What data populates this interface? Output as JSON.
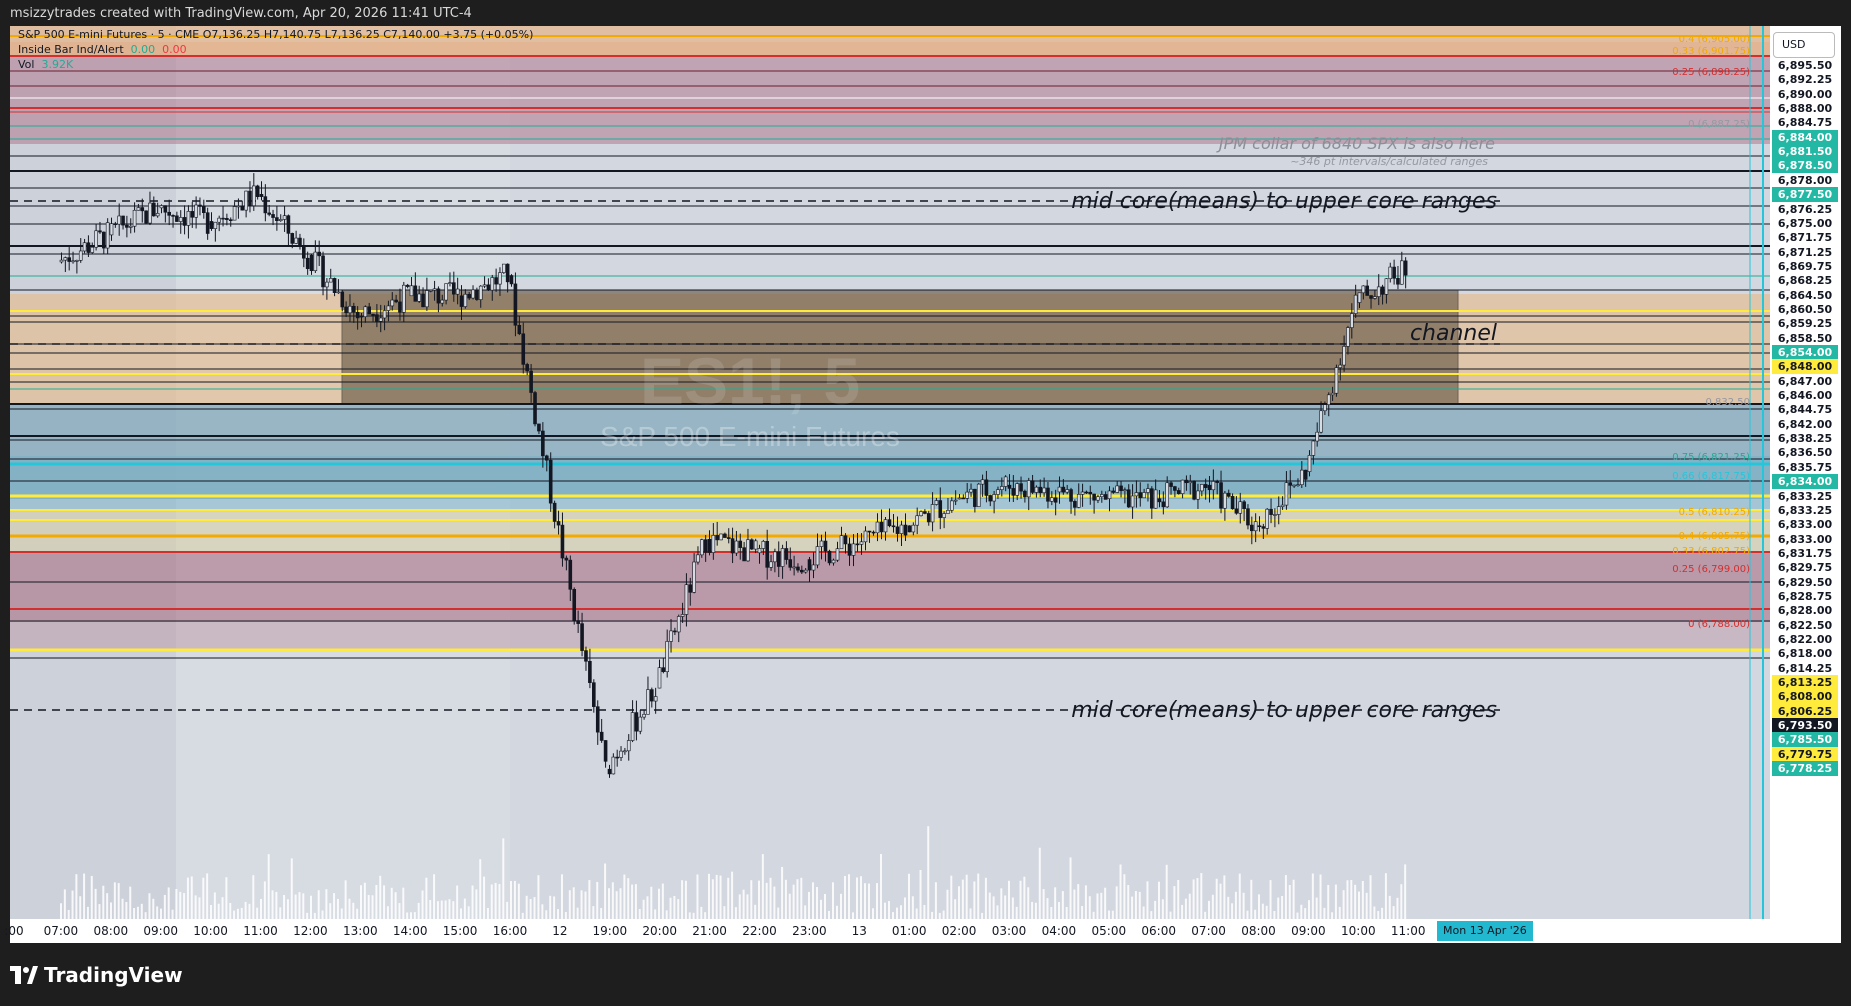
{
  "header": {
    "credit": "msizzytrades created with TradingView.com, Apr 20, 2026 11:41 UTC-4"
  },
  "legend": {
    "symbol_line": "S&P 500 E-mini Futures · 5 · CME  O7,136.25  H7,140.75  L7,136.25  C7,140.00  +3.75 (+0.05%)",
    "indicator_name": "Inside Bar Ind/Alert",
    "indicator_v1": "0.00",
    "indicator_v2": "0.00",
    "volume_name": "Vol",
    "volume_value": "3.92K"
  },
  "watermark": {
    "symbol": "ES1!, 5",
    "name": "S&P 500 E-mini Futures"
  },
  "annotations": {
    "jpm_collar": "JPM collar of 6840 SPX is also here",
    "intervals": "~346 pt intervals/calculated ranges",
    "mid_core_top": "mid core(means) to upper core ranges",
    "channel": "channel",
    "mid_core_bottom": "mid core(means) to upper core ranges"
  },
  "fib_labels": [
    {
      "text": "0.4 (6,905.00)",
      "color": "#f2a900"
    },
    {
      "text": "0.33 (6,901.75)",
      "color": "#f2a900"
    },
    {
      "text": "0.25 (6,898.25)",
      "color": "#d32f2f"
    },
    {
      "text": "0 (6,887.25)",
      "color": "#9598a1"
    },
    {
      "text": "0.832.50",
      "color": "#9598a1"
    },
    {
      "text": "0.75 (6,821.25)",
      "color": "#22ab94"
    },
    {
      "text": "0.66 (6,817.75)",
      "color": "#26c6da"
    },
    {
      "text": "0.5 (6,810.25)",
      "color": "#f2a900"
    },
    {
      "text": "0.4 (6,805.75)",
      "color": "#f2a900"
    },
    {
      "text": "0.33 (6,802.75)",
      "color": "#f2a900"
    },
    {
      "text": "0.25 (6,799.00)",
      "color": "#d32f2f"
    },
    {
      "text": "0 (6,788.00)",
      "color": "#d32f2f"
    }
  ],
  "price_axis": {
    "currency": "USD",
    "labels": [
      {
        "v": "6,895.50",
        "bg": "#ffffff",
        "fg": "#131722"
      },
      {
        "v": "6,892.25",
        "bg": "#ffffff",
        "fg": "#131722"
      },
      {
        "v": "6,890.00",
        "bg": "#ffffff",
        "fg": "#131722"
      },
      {
        "v": "6,888.00",
        "bg": "#ffffff",
        "fg": "#131722"
      },
      {
        "v": "6,884.75",
        "bg": "#ffffff",
        "fg": "#131722"
      },
      {
        "v": "6,884.00",
        "bg": "#22b8a4",
        "fg": "#ffffff"
      },
      {
        "v": "6,881.50",
        "bg": "#22b8a4",
        "fg": "#ffffff"
      },
      {
        "v": "6,878.50",
        "bg": "#22b8a4",
        "fg": "#ffffff"
      },
      {
        "v": "6,878.00",
        "bg": "#ffffff",
        "fg": "#131722"
      },
      {
        "v": "6,877.50",
        "bg": "#22b8a4",
        "fg": "#ffffff"
      },
      {
        "v": "6,876.25",
        "bg": "#ffffff",
        "fg": "#131722"
      },
      {
        "v": "6,875.00",
        "bg": "#ffffff",
        "fg": "#131722"
      },
      {
        "v": "6,871.75",
        "bg": "#ffffff",
        "fg": "#131722"
      },
      {
        "v": "6,871.25",
        "bg": "#ffffff",
        "fg": "#131722"
      },
      {
        "v": "6,869.75",
        "bg": "#ffffff",
        "fg": "#131722"
      },
      {
        "v": "6,868.25",
        "bg": "#ffffff",
        "fg": "#131722"
      },
      {
        "v": "6,864.50",
        "bg": "#ffffff",
        "fg": "#131722"
      },
      {
        "v": "6,860.50",
        "bg": "#ffffff",
        "fg": "#131722"
      },
      {
        "v": "6,859.25",
        "bg": "#ffffff",
        "fg": "#131722"
      },
      {
        "v": "6,858.50",
        "bg": "#ffffff",
        "fg": "#131722"
      },
      {
        "v": "6,854.00",
        "bg": "#22b8a4",
        "fg": "#ffffff"
      },
      {
        "v": "6,848.00",
        "bg": "#ffeb3b",
        "fg": "#131722"
      },
      {
        "v": "6,847.00",
        "bg": "#ffffff",
        "fg": "#131722"
      },
      {
        "v": "6,846.00",
        "bg": "#ffffff",
        "fg": "#131722"
      },
      {
        "v": "6,844.75",
        "bg": "#ffffff",
        "fg": "#131722"
      },
      {
        "v": "6,842.00",
        "bg": "#ffffff",
        "fg": "#131722"
      },
      {
        "v": "6,838.25",
        "bg": "#ffffff",
        "fg": "#131722"
      },
      {
        "v": "6,836.50",
        "bg": "#ffffff",
        "fg": "#131722"
      },
      {
        "v": "6,835.75",
        "bg": "#ffffff",
        "fg": "#131722"
      },
      {
        "v": "6,834.00",
        "bg": "#22b8a4",
        "fg": "#ffffff"
      },
      {
        "v": "6,833.25",
        "bg": "#ffffff",
        "fg": "#131722"
      },
      {
        "v": "6,833.25",
        "bg": "#ffffff",
        "fg": "#131722"
      },
      {
        "v": "6,833.00",
        "bg": "#ffffff",
        "fg": "#131722"
      },
      {
        "v": "6,833.00",
        "bg": "#ffffff",
        "fg": "#131722"
      },
      {
        "v": "6,831.75",
        "bg": "#ffffff",
        "fg": "#131722"
      },
      {
        "v": "6,829.75",
        "bg": "#ffffff",
        "fg": "#131722"
      },
      {
        "v": "6,829.50",
        "bg": "#ffffff",
        "fg": "#131722"
      },
      {
        "v": "6,828.75",
        "bg": "#ffffff",
        "fg": "#131722"
      },
      {
        "v": "6,828.00",
        "bg": "#ffffff",
        "fg": "#131722"
      },
      {
        "v": "6,822.50",
        "bg": "#ffffff",
        "fg": "#131722"
      },
      {
        "v": "6,822.00",
        "bg": "#ffffff",
        "fg": "#131722"
      },
      {
        "v": "6,818.00",
        "bg": "#ffffff",
        "fg": "#131722"
      },
      {
        "v": "6,814.25",
        "bg": "#ffffff",
        "fg": "#131722"
      },
      {
        "v": "6,813.25",
        "bg": "#ffeb3b",
        "fg": "#131722"
      },
      {
        "v": "6,808.00",
        "bg": "#ffeb3b",
        "fg": "#131722"
      },
      {
        "v": "6,806.25",
        "bg": "#ffeb3b",
        "fg": "#131722"
      },
      {
        "v": "6,793.50",
        "bg": "#131722",
        "fg": "#ffffff"
      },
      {
        "v": "6,785.50",
        "bg": "#22b8a4",
        "fg": "#ffffff"
      },
      {
        "v": "6,779.75",
        "bg": "#ffeb3b",
        "fg": "#131722"
      },
      {
        "v": "6,778.25",
        "bg": "#22b8a4",
        "fg": "#ffffff"
      }
    ]
  },
  "time_axis": {
    "labels": [
      ":00",
      "07:00",
      "08:00",
      "09:00",
      "10:00",
      "11:00",
      "12:00",
      "13:00",
      "14:00",
      "15:00",
      "16:00",
      "12",
      "19:00",
      "20:00",
      "21:00",
      "22:00",
      "23:00",
      "13",
      "01:00",
      "02:00",
      "03:00",
      "04:00",
      "05:00",
      "06:00",
      "07:00",
      "08:00",
      "09:00",
      "10:00",
      "11:00"
    ],
    "current_date": "Mon 13 Apr '26"
  },
  "footer": {
    "brand": "TradingView"
  },
  "chart_data": {
    "type": "candlestick",
    "symbol": "ES1!",
    "interval": "5",
    "series": [
      {
        "name": "Vol",
        "type": "volume"
      }
    ],
    "ylim": [
      6778.25,
      6905.0
    ],
    "bars": [
      {
        "time": "07:00",
        "close": 6871
      },
      {
        "time": "08:00",
        "close": 6875
      },
      {
        "time": "09:00",
        "close": 6879
      },
      {
        "time": "10:00",
        "close": 6877
      },
      {
        "time": "11:00",
        "close": 6881
      },
      {
        "time": "12:00",
        "close": 6872
      },
      {
        "time": "13:00",
        "close": 6863
      },
      {
        "time": "14:00",
        "close": 6866
      },
      {
        "time": "15:00",
        "close": 6866
      },
      {
        "time": "16:00",
        "close": 6869
      },
      {
        "time": "19:00",
        "close": 6796
      },
      {
        "time": "20:00",
        "close": 6808
      },
      {
        "time": "21:00",
        "close": 6830
      },
      {
        "time": "22:00",
        "close": 6828
      },
      {
        "time": "23:00",
        "close": 6827
      },
      {
        "time": "01:00",
        "close": 6832
      },
      {
        "time": "02:00",
        "close": 6836
      },
      {
        "time": "03:00",
        "close": 6838
      },
      {
        "time": "04:00",
        "close": 6837
      },
      {
        "time": "05:00",
        "close": 6836
      },
      {
        "time": "06:00",
        "close": 6836
      },
      {
        "time": "07:00",
        "close": 6838
      },
      {
        "time": "08:00",
        "close": 6832
      },
      {
        "time": "09:00",
        "close": 6840
      },
      {
        "time": "10:00",
        "close": 6865
      },
      {
        "time": "11:00",
        "close": 6870
      }
    ]
  }
}
